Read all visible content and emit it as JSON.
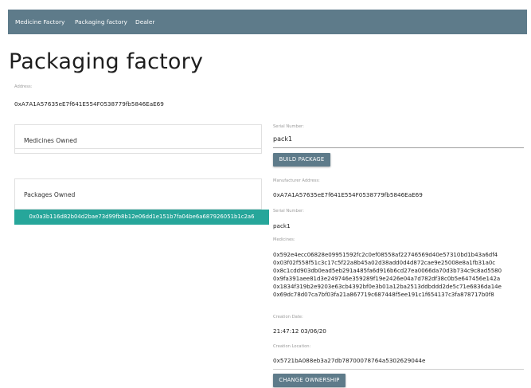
{
  "nav": {
    "items": [
      "Medicine Factory",
      "Packaging factory",
      "Dealer"
    ]
  },
  "page": {
    "title": "Packaging factory",
    "address_label": "Address:",
    "address": "0xA7A1A57635eE7f641E554F0538779fb5846EaE69"
  },
  "medicines_card": {
    "title": "Medicines Owned"
  },
  "packages_card": {
    "title": "Packages Owned",
    "items": [
      "0x0a3b116d82b04d2bae73d99fb8b12e06dd1e151b7fa04be6a687926051b1c2a6"
    ]
  },
  "build_form": {
    "serial_label": "Serial Number:",
    "serial_value": "pack1",
    "build_button": "BUILD PACKAGE"
  },
  "package_details": {
    "manufacturer_label": "Manufacturer Address:",
    "manufacturer": "0xA7A1A57635eE7f641E554F0538779fb5846EaE69",
    "serial_label": "Serial Number:",
    "serial": "pack1",
    "medicines_label": "Medicines:",
    "medicines": [
      "0x592e4ecc06828e09951592fc2c0ef08558af22746569d40e57310bd1b43a6df4",
      "0x03f02f558f51c3c17c5f22a8b45a02d38add0d4d872cae9e25008e8a1fb31a0c",
      "0x8c1cdd903db0ead5eb291a485fa6d916b6cd27ea0066da70d3b734c9c8ad5580",
      "0x9fa391aee81d3e249746e359289f19e2426e04a7d782df38c0b5e647456e142a",
      "0x1834f319b2e9203e63cb4392bf0e3b01a12ba2513ddbddd2de5c71e6836da14e",
      "0x69dc78d07ca7bf03fa21a867719c687448f5ee191c1f654137c3fa878717b0f8"
    ],
    "creation_date_label": "Creation Date:",
    "creation_date": "21:47:12 03/06/20",
    "creation_location_label": "Creation Location:",
    "creation_location": "0x5721bA088eb3a27db78700078764a5302629044e",
    "change_button": "CHANGE OWNERSHIP"
  },
  "colors": {
    "navbar": "#5e7b8a",
    "accent_teal": "#26a69a",
    "button": "#5e7b8a"
  }
}
